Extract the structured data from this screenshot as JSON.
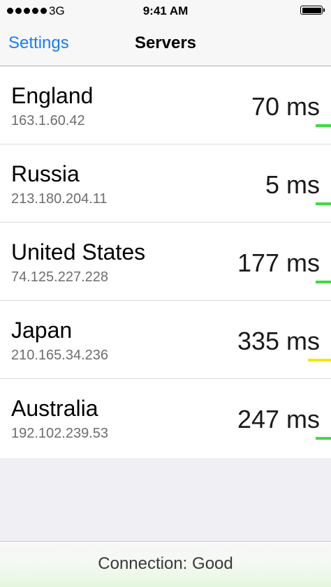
{
  "status_bar": {
    "carrier": "3G",
    "time": "9:41 AM",
    "signal_bars": 5,
    "battery_level": 1.0
  },
  "nav": {
    "back_label": "Settings",
    "title": "Servers"
  },
  "servers": [
    {
      "name": "England",
      "ip": "163.1.60.42",
      "ping": "70 ms",
      "quality_level": 0.1,
      "quality_color": "#3ddc3d"
    },
    {
      "name": "Russia",
      "ip": "213.180.204.11",
      "ping": "5 ms",
      "quality_level": 0.1,
      "quality_color": "#3ddc3d"
    },
    {
      "name": "United States",
      "ip": "74.125.227.228",
      "ping": "177 ms",
      "quality_level": 0.1,
      "quality_color": "#3ddc3d"
    },
    {
      "name": "Japan",
      "ip": "210.165.34.236",
      "ping": "335 ms",
      "quality_level": 0.15,
      "quality_color": "#f0e90e"
    },
    {
      "name": "Australia",
      "ip": "192.102.239.53",
      "ping": "247 ms",
      "quality_level": 0.1,
      "quality_color": "#3ddc3d"
    }
  ],
  "footer": {
    "status_text": "Connection: Good"
  },
  "colors": {
    "accent": "#1a7cf5",
    "good": "#3ddc3d",
    "fair": "#f0e90e"
  }
}
